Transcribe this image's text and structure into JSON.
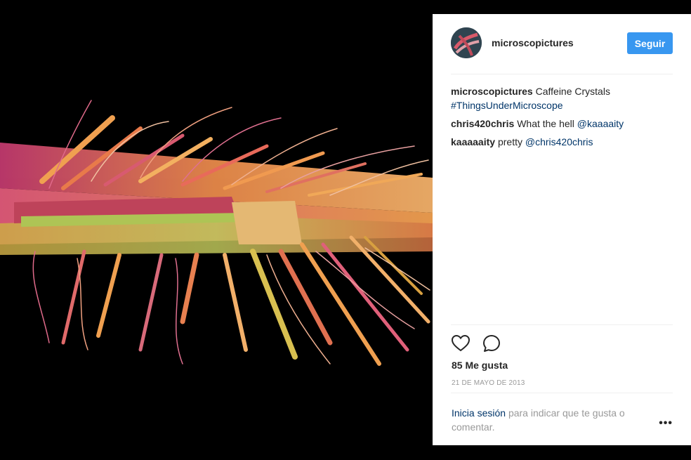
{
  "post": {
    "username": "microscopictures",
    "follow_label": "Seguir",
    "caption_author": "microscopictures",
    "caption_text": "Caffeine Crystals",
    "caption_tag": "#ThingsUnderMicroscope",
    "comments": [
      {
        "author": "chris420chris",
        "text": "What the hell",
        "mention": "@kaaaaity"
      },
      {
        "author": "kaaaaaity",
        "text": "pretty",
        "mention": "@chris420chris"
      }
    ],
    "likes": "85 Me gusta",
    "date": "21 DE MAYO DE 2013",
    "login_link": "Inicia sesión",
    "login_text": "para indicar que te gusta o comentar.",
    "more_label": "•••"
  },
  "icons": {
    "like": "heart-icon",
    "comment": "comment-icon",
    "more": "more-options-icon"
  },
  "colors": {
    "follow_button": "#3897f0",
    "link": "#003569",
    "muted": "#999999",
    "text": "#262626"
  }
}
